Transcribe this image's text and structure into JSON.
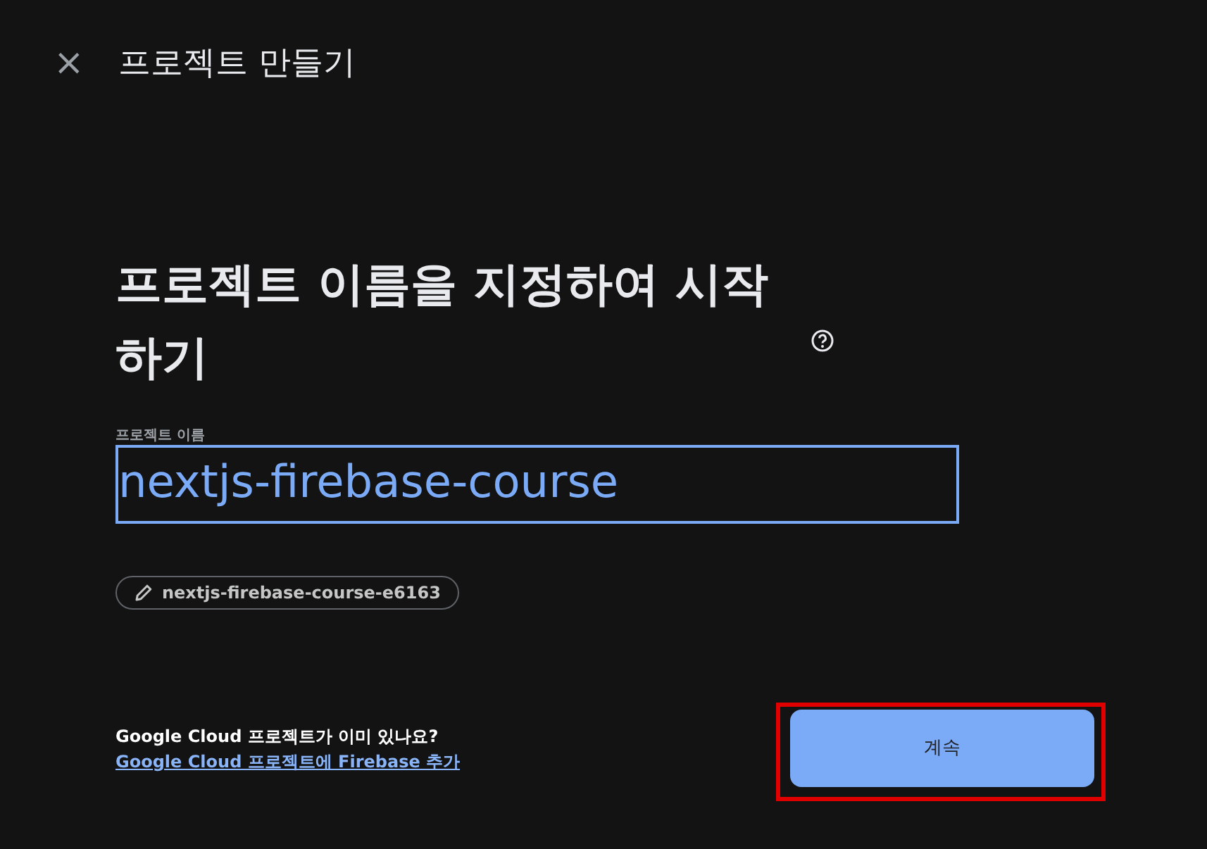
{
  "header": {
    "close": "×",
    "title": "프로젝트 만들기"
  },
  "heading": {
    "text": "프로젝트 이름을 지정하여 시작하기",
    "help": true
  },
  "name_field": {
    "label": "프로젝트 이름",
    "value": "nextjs-firebase-course",
    "focused": true
  },
  "project_id_chip": {
    "text": "nextjs-firebase-course-e6163"
  },
  "footer": {
    "question": "Google Cloud 프로젝트가 이미 있나요?",
    "link": "Google Cloud 프로젝트에 Firebase 추가"
  },
  "continue_button": {
    "label": "계속",
    "highlighted": true
  }
}
